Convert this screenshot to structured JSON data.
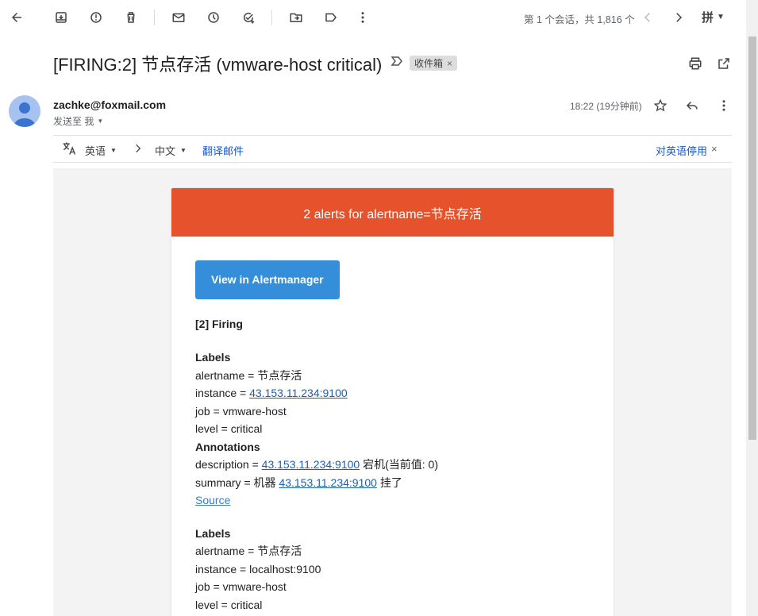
{
  "toolbar": {
    "pager_text": "第 1 个会话，共 1,816 个",
    "ime_label": "拼"
  },
  "subject": {
    "title": "[FIRING:2] 节点存活 (vmware-host critical)",
    "label_chip": "收件箱",
    "label_close": "×"
  },
  "sender": {
    "email": "zachke@foxmail.com",
    "to_text": "发送至 我",
    "time": "18:22 (19分钟前)"
  },
  "translate": {
    "from_lang": "英语",
    "to_lang": "中文",
    "translate_link": "翻译邮件",
    "disable_link": "对英语停用",
    "close": "×"
  },
  "email": {
    "header_text": "2 alerts for alertname=节点存活",
    "button_label": "View in Alertmanager",
    "firing_title": "[2] Firing",
    "alerts": [
      {
        "labels_title": "Labels",
        "alertname": "alertname = 节点存活",
        "instance_prefix": "instance = ",
        "instance_value": "43.153.11.234:9100",
        "job": "job = vmware-host",
        "level": "level = critical",
        "annotations_title": "Annotations",
        "desc_prefix": "description = ",
        "desc_link": "43.153.11.234:9100",
        "desc_suffix": " 宕机(当前值: 0)",
        "summary_prefix": "summary = 机器 ",
        "summary_link": "43.153.11.234:9100",
        "summary_suffix": " 挂了",
        "source": "Source"
      },
      {
        "labels_title": "Labels",
        "alertname": "alertname = 节点存活",
        "instance": "instance = localhost:9100",
        "job": "job = vmware-host",
        "level": "level = critical"
      }
    ]
  },
  "icons": [
    "back-arrow-icon",
    "archive-icon",
    "report-spam-icon",
    "delete-icon",
    "mark-unread-icon",
    "snooze-icon",
    "add-task-icon",
    "move-to-icon",
    "label-icon",
    "more-vert-icon",
    "prev-icon",
    "next-icon",
    "print-icon",
    "open-new-window-icon",
    "star-icon",
    "reply-icon",
    "translate-icon"
  ],
  "colors": {
    "alert_header": "#e6522c",
    "button": "#348eda",
    "link": "#1a5fb4"
  }
}
